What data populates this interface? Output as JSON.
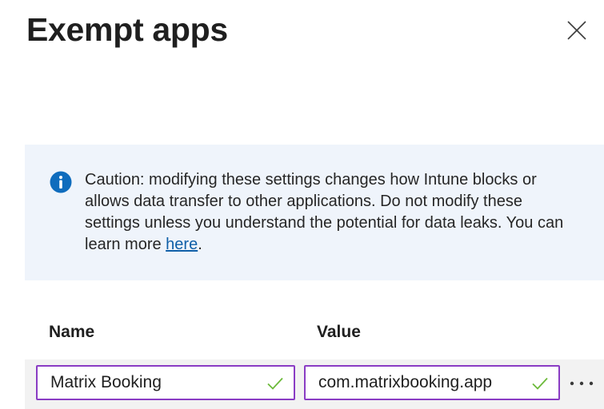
{
  "header": {
    "title": "Exempt apps",
    "close_icon": "close-icon"
  },
  "banner": {
    "icon": "info-icon",
    "text_before_link": "Caution: modifying these settings changes how Intune blocks or allows data transfer to other applications. Do not modify these settings unless you understand the potential for data leaks. You can learn more ",
    "link_label": "here",
    "text_after_link": ".",
    "background_color": "#eff4fb",
    "icon_color": "#0f6cbd"
  },
  "table": {
    "columns": [
      "Name",
      "Value"
    ],
    "rows": [
      {
        "name": "Matrix Booking",
        "value": "com.matrixbooking.app",
        "name_valid": true,
        "value_valid": true
      }
    ],
    "row_menu_icon": "more-icon",
    "field_border_color": "#8a3cc4",
    "valid_check_color": "#6cba3a"
  }
}
